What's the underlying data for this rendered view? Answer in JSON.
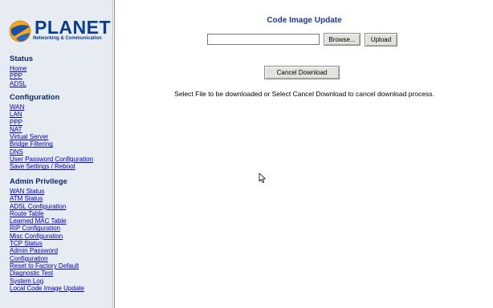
{
  "logo": {
    "brand": "PLANET",
    "tagline": "Networking & Communication"
  },
  "sidebar": {
    "sections": [
      {
        "title": "Status",
        "links": [
          "Home",
          "PPP",
          "ADSL"
        ]
      },
      {
        "title": "Configuration",
        "links": [
          "WAN",
          "LAN",
          "PPP",
          "NAT",
          "Virtual Server",
          "Bridge Filtering",
          "DNS",
          "User Password Configuration",
          "Save Settings / Reboot"
        ]
      },
      {
        "title": "Admin Privilege",
        "links": [
          "WAN Status",
          "ATM Status",
          "ADSL Configuration",
          "Route Table",
          "Learned MAC Table",
          "RIP Configuration",
          "Misc Configuration",
          "TCP Status",
          "Admin Password",
          "Configuration",
          "Reset to Factory Default",
          "Diagnostic Test",
          "System Log",
          "Local Code Image Update"
        ]
      }
    ]
  },
  "main": {
    "title": "Code Image Update",
    "file_input_value": "",
    "browse_label": "Browse...",
    "upload_label": "Upload",
    "cancel_label": "Cancel Download",
    "info": "Select File to be downloaded or Select Cancel Download to cancel download process."
  },
  "colors": {
    "brand": "#0a3d8f",
    "link": "#0000cc",
    "sidebar_bg": "#e7ecf2",
    "title": "#1f3a8a"
  }
}
